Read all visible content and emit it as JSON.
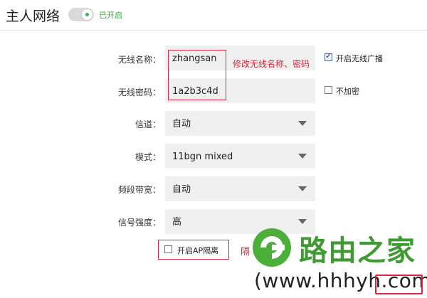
{
  "header": {
    "title": "主人网络",
    "toggle_status": "已开启"
  },
  "form": {
    "ssid": {
      "label": "无线名称：",
      "value": "zhangsan"
    },
    "password": {
      "label": "无线密码：",
      "value": "1a2b3c4d"
    },
    "channel": {
      "label": "信道：",
      "value": "自动"
    },
    "mode": {
      "label": "模式：",
      "value": "11bgn mixed"
    },
    "bandwidth": {
      "label": "频段带宽：",
      "value": "自动"
    },
    "power": {
      "label": "信号强度：",
      "value": "高"
    },
    "broadcast": {
      "label": "开启无线广播",
      "checked": true
    },
    "no_encrypt": {
      "label": "不加密",
      "checked": false
    },
    "ap_isolation": {
      "label": "开启AP隔离",
      "checked": false
    }
  },
  "annotation": "修改无线名称、密码",
  "partial_text": "隔",
  "watermark": {
    "brand": "路由之家",
    "url": "(www.hhhyh.com)"
  },
  "colors": {
    "accent_green": "#3cb74a",
    "annotation_red": "#d9263a"
  }
}
